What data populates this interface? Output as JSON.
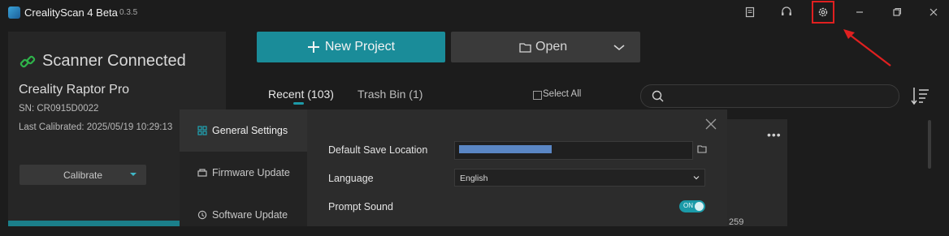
{
  "app": {
    "title": "CrealityScan 4 Beta",
    "version": "0.3.5"
  },
  "titlebar": {
    "icons": [
      "notes-icon",
      "headset-icon",
      "settings-icon",
      "minimize-icon",
      "restore-icon",
      "close-icon"
    ]
  },
  "device": {
    "status": "Scanner Connected",
    "name": "Creality Raptor Pro",
    "sn": "SN: CR0915D0022",
    "last_calibrated": "Last Calibrated: 2025/05/19 10:29:13",
    "calibrate_label": "Calibrate"
  },
  "toolbar": {
    "new_project": "New Project",
    "open": "Open"
  },
  "tabs": {
    "recent": "Recent (103)",
    "trash": "Trash Bin (1)",
    "select_all": "Select All"
  },
  "card": {
    "number_fragment": "259"
  },
  "settings_dialog": {
    "nav": [
      {
        "label": "General Settings",
        "active": true
      },
      {
        "label": "Firmware Update",
        "active": false
      },
      {
        "label": "Software Update",
        "active": false
      }
    ],
    "rows": {
      "save_location_label": "Default Save Location",
      "language_label": "Language",
      "language_value": "English",
      "prompt_sound_label": "Prompt Sound",
      "prompt_sound_state": "ON"
    }
  },
  "colors": {
    "accent": "#1a8c99",
    "highlight": "#e02020"
  }
}
